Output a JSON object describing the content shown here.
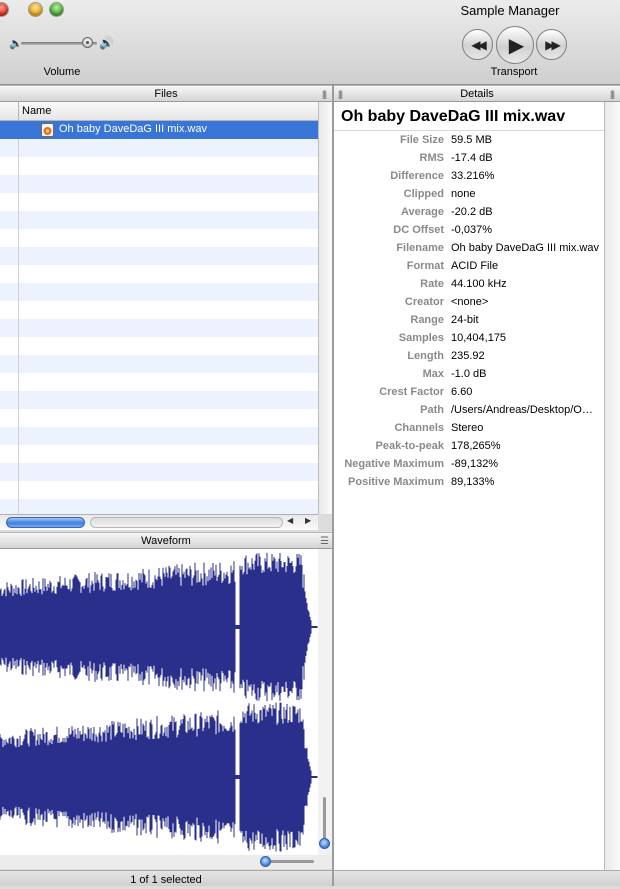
{
  "window": {
    "title": "Sample Manager"
  },
  "toolbar": {
    "volume_label": "Volume",
    "volume_low_icon": "🔈",
    "volume_high_icon": "🔊",
    "transport_label": "Transport",
    "rewind_icon": "◀◀",
    "play_icon": "▶",
    "forward_icon": "▶▶"
  },
  "files": {
    "title": "Files",
    "column_name": "Name",
    "rows": [
      {
        "name": "Oh baby DaveDaG III mix.wav",
        "selected": true
      }
    ],
    "scroll_left": "◀",
    "scroll_right": "▶"
  },
  "waveform": {
    "title": "Waveform",
    "status": "1 of 1 selected"
  },
  "details": {
    "title": "Details",
    "heading": "Oh baby DaveDaG III mix.wav",
    "fields": [
      {
        "key": "File Size",
        "value": "59.5 MB"
      },
      {
        "key": "RMS",
        "value": "-17.4 dB"
      },
      {
        "key": "Difference",
        "value": "33.216%"
      },
      {
        "key": "Clipped",
        "value": "none"
      },
      {
        "key": "Average",
        "value": "-20.2 dB"
      },
      {
        "key": "DC Offset",
        "value": "-0,037%"
      },
      {
        "key": "Filename",
        "value": "Oh baby DaveDaG III mix.wav"
      },
      {
        "key": "Format",
        "value": "ACID File"
      },
      {
        "key": "Rate",
        "value": "44.100 kHz"
      },
      {
        "key": "Creator",
        "value": "<none>"
      },
      {
        "key": "Range",
        "value": "24-bit"
      },
      {
        "key": "Samples",
        "value": "10,404,175"
      },
      {
        "key": "Length",
        "value": "235.92"
      },
      {
        "key": "Max",
        "value": "-1.0 dB"
      },
      {
        "key": "Crest Factor",
        "value": "6.60"
      },
      {
        "key": "Path",
        "value": "/Users/Andreas/Desktop/O…"
      },
      {
        "key": "Channels",
        "value": "Stereo"
      },
      {
        "key": "Peak-to-peak",
        "value": "178,265%"
      },
      {
        "key": "Negative Maximum",
        "value": "-89,132%"
      },
      {
        "key": "Positive Maximum",
        "value": "89,133%"
      }
    ]
  },
  "colors": {
    "waveform": "#2a2f8c",
    "selection": "#3875d7",
    "stripe": "#edf3fe"
  }
}
